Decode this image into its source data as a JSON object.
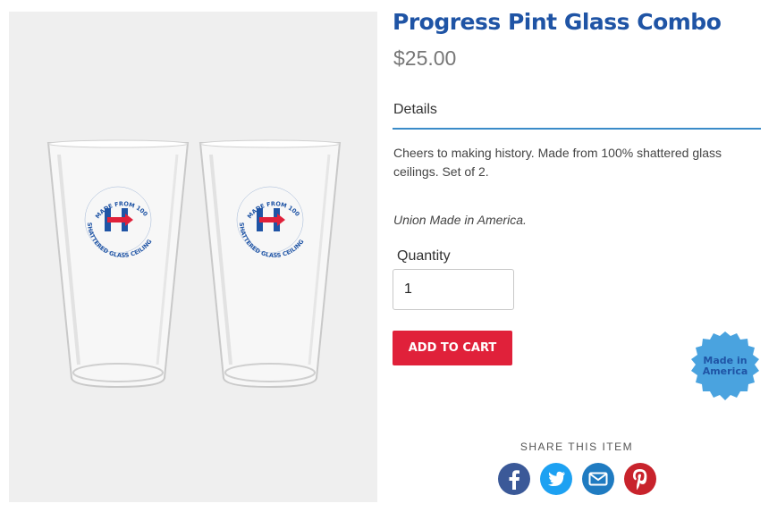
{
  "product": {
    "title": "Progress Pint Glass Combo",
    "price": "$25.00",
    "details_tab": "Details",
    "description": "Cheers to making history. Made from 100% shattered glass ceilings. Set of 2.",
    "union_note": "Union Made in America.",
    "quantity_label": "Quantity",
    "quantity_value": "1",
    "add_to_cart": "ADD TO CART"
  },
  "badge": {
    "line1": "Made in",
    "line2": "America"
  },
  "glass_print": {
    "top_text": "MADE FROM 100%",
    "bottom_text": "SHATTERED GLASS CEILING"
  },
  "share": {
    "label": "SHARE THIS ITEM",
    "icons": [
      "facebook-icon",
      "twitter-icon",
      "email-icon",
      "pinterest-icon"
    ]
  },
  "colors": {
    "brand_blue": "#1f54a5",
    "cart_red": "#e0213a",
    "rule_blue": "#3a8bc8",
    "badge_blue": "#4aa3df",
    "pinterest_red": "#c8232c"
  }
}
